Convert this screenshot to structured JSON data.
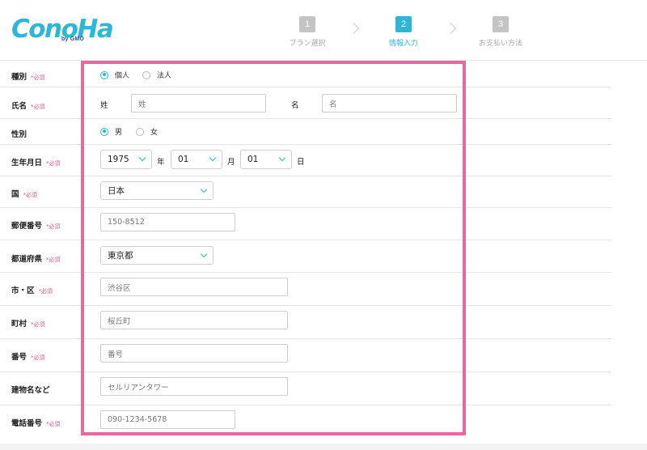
{
  "header": {
    "logo_text": "ConoHa",
    "logo_sub": "by GMO",
    "steps": [
      {
        "num": "1",
        "label": "プラン選択"
      },
      {
        "num": "2",
        "label": "情報入力"
      },
      {
        "num": "3",
        "label": "お支払い方法"
      }
    ],
    "active_step": 2
  },
  "required_mark": "*必須",
  "form": {
    "type": {
      "label": "種別",
      "options": [
        "個人",
        "法人"
      ],
      "selected": "個人"
    },
    "name": {
      "label": "氏名",
      "last_label": "姓",
      "last_placeholder": "姓",
      "first_label": "名",
      "first_placeholder": "名"
    },
    "gender": {
      "label": "性別",
      "options": [
        "男",
        "女"
      ],
      "selected": "男"
    },
    "birth": {
      "label": "生年月日",
      "year": "1975",
      "year_unit": "年",
      "month": "01",
      "month_unit": "月",
      "day": "01",
      "day_unit": "日"
    },
    "country": {
      "label": "国",
      "value": "日本"
    },
    "postal": {
      "label": "郵便番号",
      "placeholder": "150-8512"
    },
    "prefecture": {
      "label": "都道府県",
      "value": "東京都"
    },
    "city": {
      "label": "市・区",
      "placeholder": "渋谷区"
    },
    "town": {
      "label": "町村",
      "placeholder": "桜丘町"
    },
    "number": {
      "label": "番号",
      "placeholder": "番号"
    },
    "building": {
      "label": "建物名など",
      "placeholder": "セルリアンタワー"
    },
    "phone": {
      "label": "電話番号",
      "placeholder": "090-1234-5678"
    }
  },
  "colors": {
    "accent": "#2cb7d8",
    "highlight": "#e8679c",
    "required": "#e05a8a"
  }
}
